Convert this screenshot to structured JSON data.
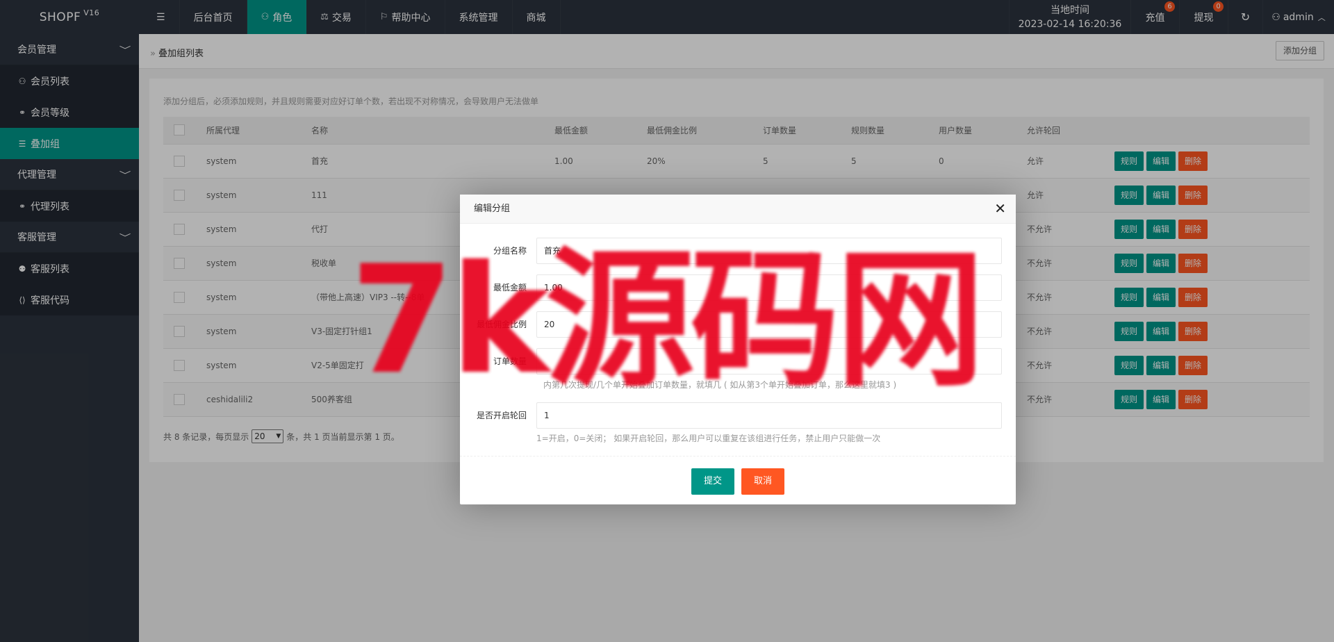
{
  "topbar": {
    "logo": "SHOPF",
    "version": "V16",
    "nav": [
      {
        "icon": "menu-icon",
        "label": ""
      },
      {
        "label": "后台首页"
      },
      {
        "icon": "user-icon",
        "label": "角色"
      },
      {
        "icon": "scale-icon",
        "label": "交易"
      },
      {
        "icon": "flag-icon",
        "label": "帮助中心"
      },
      {
        "label": "系统管理"
      },
      {
        "label": "商城"
      }
    ],
    "time_label": "当地时间",
    "time_value": "2023-02-14 16:20:36",
    "recharge_label": "充值",
    "recharge_badge": "6",
    "withdraw_label": "提现",
    "withdraw_badge": "0",
    "user": "admin"
  },
  "sidebar": {
    "groups": [
      {
        "label": "会员管理",
        "items": [
          {
            "icon": "user-icon",
            "label": "会员列表"
          },
          {
            "icon": "link-icon",
            "label": "会员等级"
          },
          {
            "icon": "list-icon",
            "label": "叠加组",
            "active": true
          }
        ]
      },
      {
        "label": "代理管理",
        "items": [
          {
            "icon": "link-icon",
            "label": "代理列表"
          }
        ]
      },
      {
        "label": "客服管理",
        "items": [
          {
            "icon": "users-icon",
            "label": "客服列表"
          },
          {
            "icon": "code-icon",
            "label": "客服代码"
          }
        ]
      }
    ]
  },
  "page": {
    "breadcrumb": "叠加组列表",
    "add_button": "添加分组",
    "tip": "添加分组后，必须添加规则，并且规则需要对应好订单个数，若出现不对称情况，会导致用户无法做单",
    "columns": [
      "所属代理",
      "名称",
      "最低金额",
      "最低佣金比例",
      "订单数量",
      "规则数量",
      "用户数量",
      "允许轮回"
    ],
    "rows": [
      {
        "agent": "system",
        "name": "首充",
        "min": "1.00",
        "ratio": "20%",
        "orders": "5",
        "rules": "5",
        "users": "0",
        "cycle": "允许"
      },
      {
        "agent": "system",
        "name": "111",
        "min": "",
        "ratio": "",
        "orders": "",
        "rules": "",
        "users": "",
        "cycle": "允许"
      },
      {
        "agent": "system",
        "name": "代打",
        "min": "",
        "ratio": "",
        "orders": "",
        "rules": "",
        "users": "",
        "cycle": "不允许"
      },
      {
        "agent": "system",
        "name": "税收单",
        "min": "",
        "ratio": "",
        "orders": "",
        "rules": "",
        "users": "",
        "cycle": "不允许"
      },
      {
        "agent": "system",
        "name": "（带他上高速）VIP3 --转--8单",
        "min": "",
        "ratio": "",
        "orders": "",
        "rules": "",
        "users": "",
        "cycle": "不允许"
      },
      {
        "agent": "system",
        "name": "V3-固定打针组1",
        "min": "",
        "ratio": "",
        "orders": "",
        "rules": "",
        "users": "",
        "cycle": "不允许"
      },
      {
        "agent": "system",
        "name": "V2-5单固定打",
        "min": "",
        "ratio": "",
        "orders": "",
        "rules": "",
        "users": "",
        "cycle": "不允许"
      },
      {
        "agent": "ceshidalili2",
        "name": "500养客组",
        "min": "",
        "ratio": "",
        "orders": "",
        "rules": "",
        "users": "",
        "cycle": "不允许"
      }
    ],
    "actions": {
      "rule": "规则",
      "edit": "编辑",
      "delete": "删除"
    },
    "pager": {
      "pre": "共 8 条记录，每页显示",
      "size": "20",
      "post": "条，共 1 页当前显示第 1 页。"
    }
  },
  "modal": {
    "title": "编辑分组",
    "fields": [
      {
        "label": "分组名称",
        "value": "首充"
      },
      {
        "label": "最低金额",
        "value": "1.00"
      },
      {
        "label": "最低佣金比例",
        "value": "20"
      },
      {
        "label": "订单数量",
        "value": "",
        "hint": "内第几次提现/几个单开始叠加订单数量，就填几 ( 如从第3个单开始叠加订单，那么这里就填3 )"
      },
      {
        "label": "是否开启轮回",
        "value": "1",
        "hint": "1=开启，0=关闭； 如果开启轮回，那么用户可以重复在该组进行任务，禁止用户只能做一次"
      }
    ],
    "submit": "提交",
    "cancel": "取消"
  },
  "watermark": "7k源码网"
}
